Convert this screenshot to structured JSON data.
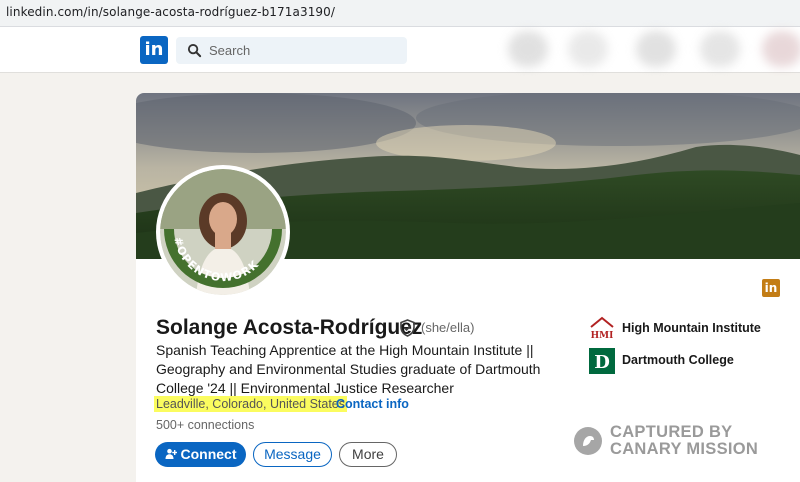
{
  "browser": {
    "url": "linkedin.com/in/solange-acosta-rodríguez-b171a3190/"
  },
  "nav": {
    "logo_text": "in",
    "search_placeholder": "Search"
  },
  "profile": {
    "name": "Solange Acosta-Rodríguez",
    "pronouns": "(she/ella)",
    "headline": "Spanish Teaching Apprentice at the High Mountain Institute || Geography and Environmental Studies graduate of Dartmouth College '24 || Environmental Justice Researcher",
    "location": "Leadville, Colorado, United States",
    "separator": "·",
    "contact_info": "Contact info",
    "connections": "500+ connections",
    "open_to_work": "#OPENTOWORK",
    "badge_text": "in"
  },
  "actions": {
    "connect": "Connect",
    "message": "Message",
    "more": "More"
  },
  "education": [
    {
      "name": "High Mountain Institute",
      "logo_text": "HMI",
      "color": "#b22222"
    },
    {
      "name": "Dartmouth College",
      "logo_text": "D",
      "color": "#00693e"
    }
  ],
  "watermark": {
    "line1": "CAPTURED BY",
    "line2": "CANARY MISSION"
  },
  "colors": {
    "linkedin_blue": "#0a66c2",
    "open_to_work_green": "#44712e",
    "highlight": "#fbfc5f"
  }
}
